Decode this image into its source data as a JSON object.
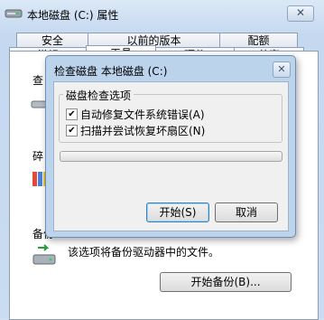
{
  "outer_window": {
    "title": "本地磁盘 (C:) 属性",
    "close_glyph": "✕",
    "tabs_row1": [
      "安全",
      "以前的版本",
      "配额"
    ],
    "tabs_row2": [
      "常规",
      "工具",
      "硬件",
      "共享"
    ],
    "sections": [
      "查",
      "碎",
      "备份"
    ],
    "backup_description": "该选项将备份驱动器中的文件。",
    "backup_button": "开始备份(B)..."
  },
  "dialog": {
    "title": "检查磁盘 本地磁盘 (C:)",
    "close_glyph": "✕",
    "group_label": "磁盘检查选项",
    "options": [
      {
        "label": "自动修复文件系统错误(A)",
        "checked": true
      },
      {
        "label": "扫描并尝试恢复坏扇区(N)",
        "checked": true
      }
    ],
    "progress": 0,
    "start_button": "开始(S)",
    "cancel_button": "取消"
  },
  "icons": {
    "drive": "hard-drive-icon",
    "backup": "backup-icon",
    "defrag": "defrag-icon",
    "check": "check-disk-icon"
  }
}
